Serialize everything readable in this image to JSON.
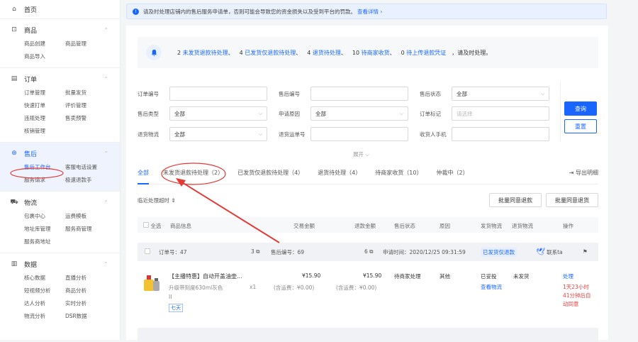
{
  "sidebar": {
    "home": "首页",
    "sections": [
      {
        "title": "商品",
        "items": [
          "商品创建",
          "商品管理",
          "商品导入"
        ]
      },
      {
        "title": "订单",
        "items": [
          "订单管理",
          "批量发货",
          "快速打单",
          "评价管理",
          "违规处理",
          "售卖预警",
          "核销管理"
        ]
      },
      {
        "title": "售后",
        "items": [
          "售后工作台",
          "客服电话设置",
          "服务请求",
          "极速退款手"
        ]
      },
      {
        "title": "物流",
        "items": [
          "包裹中心",
          "运费模板",
          "地址库管理",
          "服务商管理",
          "服务商地址"
        ]
      },
      {
        "title": "数据",
        "items": [
          "核心数据",
          "直播分析",
          "短视频分析",
          "商品分析",
          "达人分析",
          "实时分析",
          "物流分析",
          "DSR数据"
        ]
      }
    ]
  },
  "notice": {
    "text": "请及时处理店铺内的售后服务申请单，否则可能会导致您的资金损失以及受到平台的罚款。",
    "link": "查看详情 ›"
  },
  "summary": [
    {
      "num": "2",
      "label": "未发货退款待处理"
    },
    {
      "num": "4",
      "label": "已发货仅退款待处理"
    },
    {
      "num": "4",
      "label": "退货待处理"
    },
    {
      "num": "10",
      "label": "待商家收货"
    },
    {
      "num": "0",
      "label": "待上传退款凭证"
    }
  ],
  "summary_tail": "，请及时处理。",
  "filters": {
    "order_no": "订单编号",
    "after_no": "售后编号",
    "after_status": "售后状态",
    "after_status_val": "全部",
    "after_type": "售后类型",
    "after_type_val": "全部",
    "apply_reason": "申请原因",
    "apply_reason_val": "全部",
    "order_mark": "订单标记",
    "order_mark_ph": "请选择",
    "return_logistics": "退货物流",
    "return_logistics_val": "全部",
    "return_waybill": "退货运单号",
    "receiver_phone": "收货人手机"
  },
  "buttons": {
    "query": "查询",
    "reset": "重置",
    "expand": "展开 ⌵",
    "export": "导出明细",
    "batch_refund": "批量同意退款",
    "batch_return": "批量同意退货"
  },
  "tabs": [
    "全部",
    "未发货退款待处理（2）",
    "已发货仅退款待处理（4）",
    "退货待处理（4）",
    "待商家收货（10）",
    "仲裁中（2）"
  ],
  "sort_label": "临近处理超时 ⇕",
  "table_head": [
    "全选",
    "商品信息",
    "交易金额",
    "退款金额",
    "售后状态",
    "原因",
    "发货物流",
    "退货物流",
    "操作"
  ],
  "order": {
    "order_no": "订单号：47",
    "order_no_copy": "3",
    "after_no": "售后编号：69",
    "after_no_copy": "6",
    "apply_time": "申请时间：2020/12/25 09:31:59",
    "tag": "已发货仅退款",
    "contact": "联系ta"
  },
  "product": {
    "title": "【主播特惠】自动开盖油壶...",
    "spec": "升级带刻度630ml灰色",
    "spec2": "II",
    "badge": "七天",
    "qty": "x1",
    "trade_amount": "¥15.90",
    "trade_freight": "(含运费：¥0.00)",
    "refund_amount": "¥15.90",
    "refund_freight": "(含运费：¥0.00)",
    "status": "待商家处理",
    "reason": "其他",
    "ship_status": "已妥投",
    "ship_link": "查看物流",
    "return_status": "未发货",
    "action": "处理",
    "countdown": [
      "1天23小时",
      "41分钟后自",
      "动同意"
    ]
  },
  "colors": {
    "accent": "#1966ff",
    "annotation": "#e53935"
  }
}
